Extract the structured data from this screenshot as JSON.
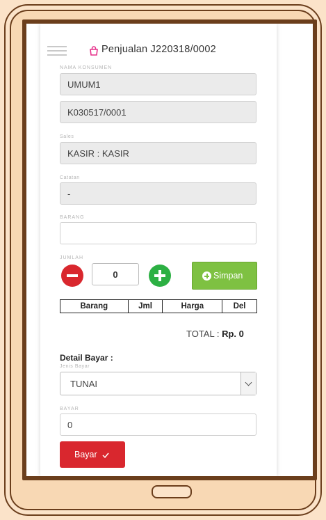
{
  "header": {
    "title": "Penjualan J220318/0002"
  },
  "form": {
    "customer_label": "NAMA KONSUMEN",
    "customer_value": "UMUM1",
    "customer_code": "K030517/0001",
    "sales_label": "Sales",
    "sales_value": "KASIR : KASIR",
    "note_label": "Catatan",
    "note_value": "-",
    "item_label": "BARANG",
    "item_value": "",
    "qty_label": "JUMLAH",
    "qty_value": "0",
    "save_label": "Simpan"
  },
  "table": {
    "columns": [
      "Barang",
      "Jml",
      "Harga",
      "Del"
    ]
  },
  "total": {
    "label": "TOTAL :",
    "value": "Rp. 0"
  },
  "payment": {
    "title": "Detail Bayar :",
    "type_label": "Jenis Bayar",
    "type_value": "TUNAI",
    "amount_label": "BAYAR",
    "amount_value": "0",
    "pay_label": "Bayar"
  },
  "colors": {
    "danger": "#d9272e",
    "success": "#2cb043",
    "save": "#7ec142",
    "frame": "#6b3e1c"
  }
}
